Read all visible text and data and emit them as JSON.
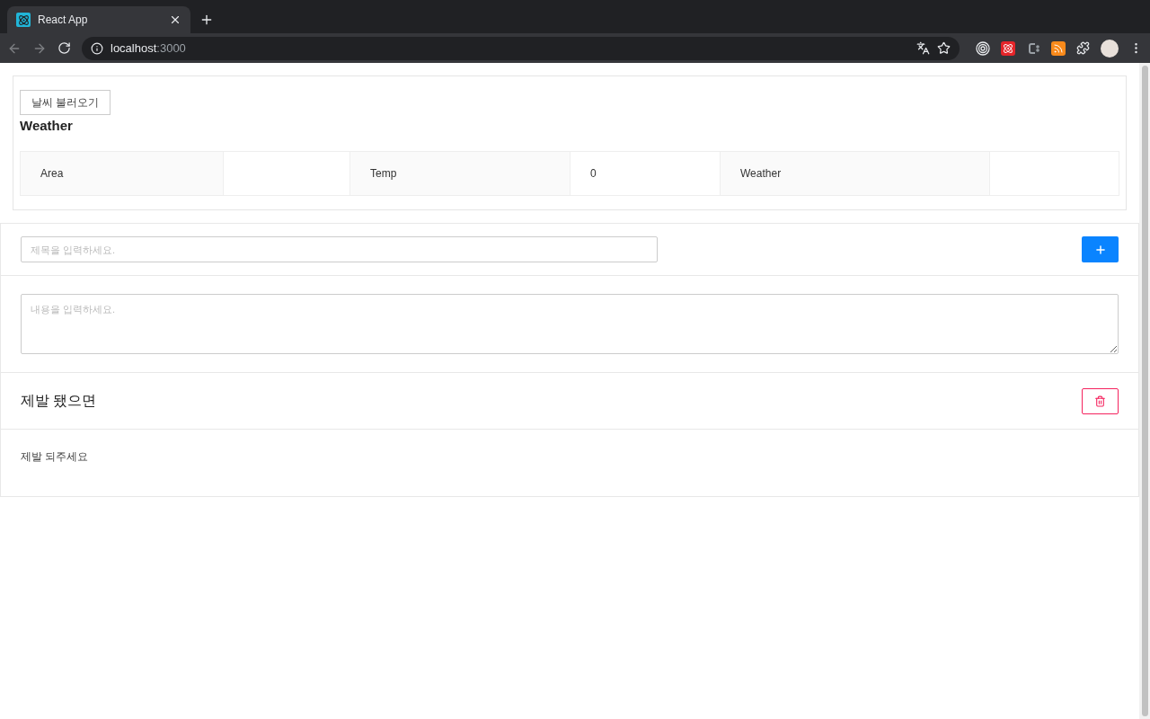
{
  "browser": {
    "tab": {
      "title": "React App"
    },
    "address": {
      "host": "localhost",
      "port": ":3000"
    }
  },
  "weather": {
    "load_button": "날씨 불러오기",
    "heading": "Weather",
    "table": {
      "rows": [
        {
          "label": "Area"
        },
        {
          "label": "Temp",
          "value": "0"
        },
        {
          "label": "Weather"
        }
      ]
    }
  },
  "memo_form": {
    "title_field": {
      "placeholder": "제목을 입력하세요."
    },
    "content_field": {
      "placeholder": "내용을 입력하세요."
    }
  },
  "notes": [
    {
      "title": "제발 됐으면",
      "body": "제발 되주세요"
    }
  ]
}
